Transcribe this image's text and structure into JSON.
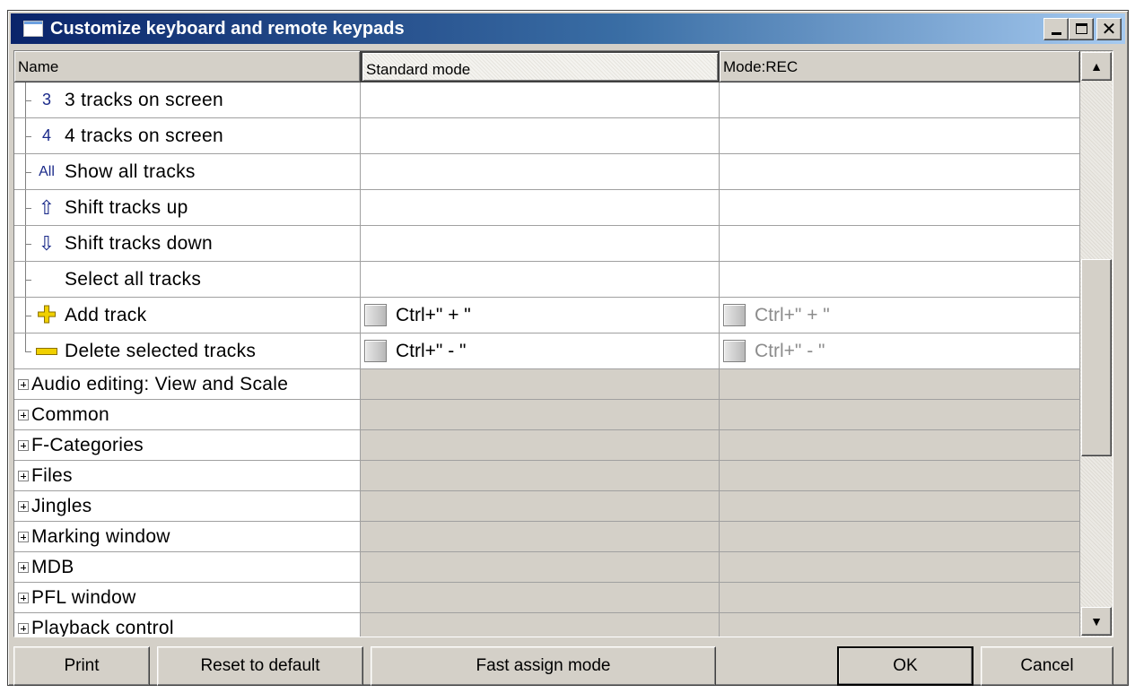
{
  "window": {
    "title": "Customize keyboard and remote keypads",
    "close_glyph": "✕"
  },
  "columns": {
    "name": "Name",
    "standard": "Standard mode",
    "rec": "Mode:REC"
  },
  "items": [
    {
      "icon": "3",
      "label": "3 tracks on screen",
      "std": "",
      "rec": ""
    },
    {
      "icon": "4",
      "label": "4 tracks on screen",
      "std": "",
      "rec": ""
    },
    {
      "icon": "All",
      "label": "Show all tracks",
      "std": "",
      "rec": ""
    },
    {
      "icon": "⇧",
      "label": "Shift tracks up",
      "std": "",
      "rec": ""
    },
    {
      "icon": "⇩",
      "label": "Shift tracks down",
      "std": "",
      "rec": ""
    },
    {
      "icon": "",
      "label": "Select all tracks",
      "std": "",
      "rec": ""
    },
    {
      "icon": "✚",
      "label": "Add track",
      "std": "Ctrl+\" + \"",
      "rec": "Ctrl+\" + \""
    },
    {
      "icon": "",
      "label": "Delete selected tracks",
      "std": "Ctrl+\" - \"",
      "rec": "Ctrl+\" - \""
    }
  ],
  "categories": [
    "Audio editing: View and Scale",
    "Common",
    "F-Categories",
    "Files",
    "Jingles",
    "Marking window",
    "MDB",
    "PFL window",
    "Playback control"
  ],
  "scroll": {
    "up": "▲",
    "down": "▼"
  },
  "buttons": {
    "print": "Print",
    "reset": "Reset to default",
    "fast_assign": "Fast assign mode",
    "ok": "OK",
    "cancel": "Cancel"
  }
}
